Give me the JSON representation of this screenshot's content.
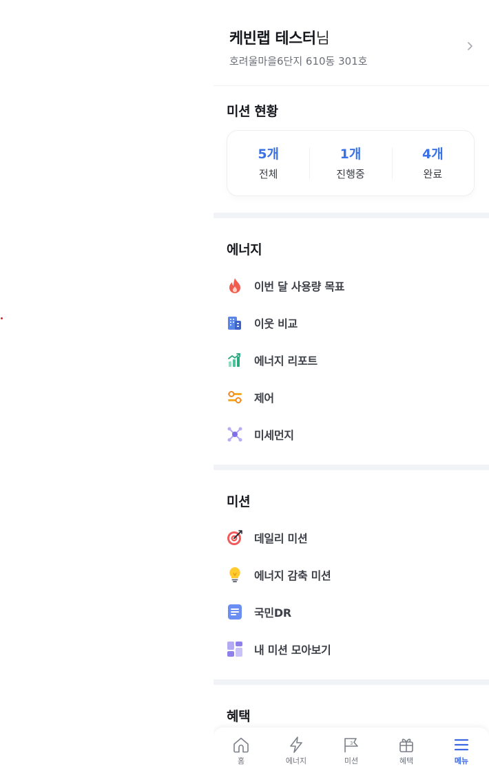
{
  "profile": {
    "name": "케빈랩 테스터",
    "name_suffix": "님",
    "address": "호려울마을6단지 610동 301호"
  },
  "mission_status": {
    "title": "미션 현황",
    "stats": [
      {
        "value": "5개",
        "label": "전체"
      },
      {
        "value": "1개",
        "label": "진행중"
      },
      {
        "value": "4개",
        "label": "완료"
      }
    ]
  },
  "energy": {
    "title": "에너지",
    "items": [
      {
        "label": "이번 달 사용량 목표",
        "icon": "fire-icon"
      },
      {
        "label": "이웃 비교",
        "icon": "building-icon"
      },
      {
        "label": "에너지 리포트",
        "icon": "chart-growth-icon"
      },
      {
        "label": "제어",
        "icon": "control-switch-icon"
      },
      {
        "label": "미세먼지",
        "icon": "fine-dust-icon"
      }
    ]
  },
  "mission": {
    "title": "미션",
    "items": [
      {
        "label": "데일리 미션",
        "icon": "target-icon"
      },
      {
        "label": "에너지 감축 미션",
        "icon": "lightbulb-icon"
      },
      {
        "label": "국민DR",
        "icon": "document-icon"
      },
      {
        "label": "내 미션 모아보기",
        "icon": "grid-icon"
      }
    ]
  },
  "benefit": {
    "title": "혜택"
  },
  "tabbar": {
    "items": [
      {
        "label": "홈",
        "icon": "home-icon"
      },
      {
        "label": "에너지",
        "icon": "lightning-icon"
      },
      {
        "label": "미션",
        "icon": "flag-icon"
      },
      {
        "label": "혜택",
        "icon": "gift-icon"
      },
      {
        "label": "메뉴",
        "icon": "menu-icon",
        "active": true
      }
    ]
  },
  "colors": {
    "accent": "#3a72e6",
    "active_tab": "#3b68e0",
    "divider": "#f2f3f6"
  }
}
